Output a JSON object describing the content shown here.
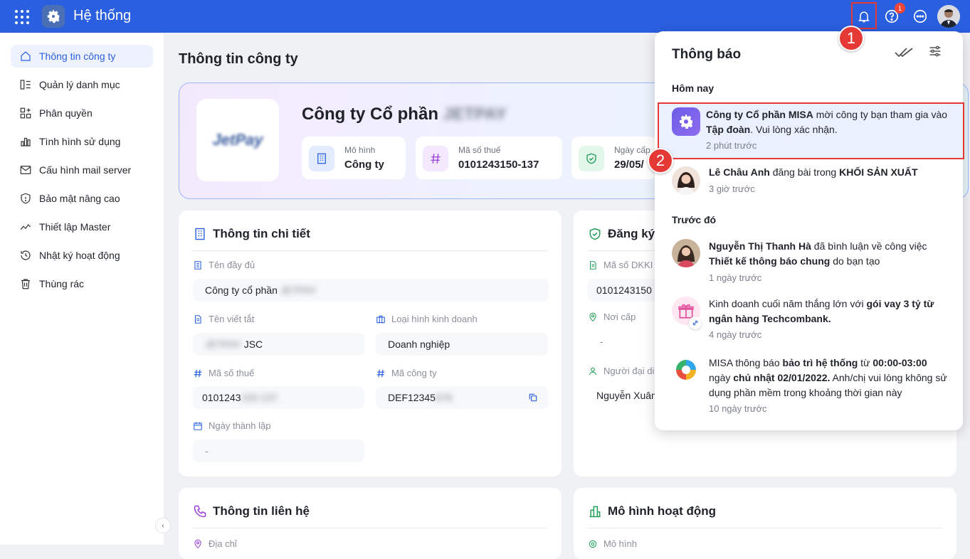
{
  "app": {
    "title": "Hệ thống",
    "help_badge": "1"
  },
  "sidebar": {
    "items": [
      {
        "label": "Thông tin công ty",
        "icon": "home-icon"
      },
      {
        "label": "Quản lý danh mục",
        "icon": "list-icon"
      },
      {
        "label": "Phân quyền",
        "icon": "grid-plus-icon"
      },
      {
        "label": "Tình hình sử dụng",
        "icon": "bar-chart-icon"
      },
      {
        "label": "Cấu hình mail server",
        "icon": "mail-icon"
      },
      {
        "label": "Bảo mật nâng cao",
        "icon": "shield-icon"
      },
      {
        "label": "Thiết lập Master",
        "icon": "trend-icon"
      },
      {
        "label": "Nhật ký hoạt động",
        "icon": "history-icon"
      },
      {
        "label": "Thùng rác",
        "icon": "trash-icon"
      }
    ]
  },
  "page": {
    "title": "Thông tin công ty"
  },
  "hero": {
    "logo_text": "JetPay",
    "name_prefix": "Công ty Cổ phần",
    "name_blur": "JETPAY",
    "stats": [
      {
        "label": "Mô hình",
        "value": "Công ty"
      },
      {
        "label": "Mã số thuế",
        "value": "0101243150-137"
      },
      {
        "label": "Ngày cấp",
        "value": "29/05/"
      }
    ]
  },
  "detail": {
    "title": "Thông tin chi tiết",
    "full_name": {
      "label": "Tên đầy đủ",
      "value": "Công ty cổ phần",
      "blur": "JETPAY"
    },
    "short_name": {
      "label": "Tên viết tắt",
      "blur": "JETPAY",
      "value": "JSC"
    },
    "business_type": {
      "label": "Loại hình kinh doanh",
      "value": "Doanh nghiệp"
    },
    "tax_code": {
      "label": "Mã số thuế",
      "value": "0101243",
      "blur": "150-137"
    },
    "company_code": {
      "label": "Mã công ty",
      "value": "DEF12345",
      "blur": "678"
    },
    "founded": {
      "label": "Ngày thành lập",
      "value": "-"
    }
  },
  "register": {
    "title": "Đăng ký",
    "dkkd": {
      "label": "Mã số DKKI",
      "value": "0101243150"
    },
    "place": {
      "label": "Nơi cấp",
      "value": "-"
    },
    "rep": {
      "label": "Người đại di",
      "value": "Nguyễn Xuân"
    }
  },
  "contact": {
    "title": "Thông tin liên hệ",
    "address_label": "Địa chỉ"
  },
  "model": {
    "title": "Mô hình hoạt động",
    "field_label": "Mô hình"
  },
  "notifications": {
    "title": "Thông báo",
    "today_label": "Hôm nay",
    "earlier_label": "Trước đó",
    "items": [
      {
        "bold1": "Công ty Cổ phần MISA",
        "text1": " mời công ty bạn tham gia vào ",
        "bold2": "Tập đoàn",
        "text2": ". Vui lòng xác nhận.",
        "time": "2 phút trước"
      },
      {
        "bold1": "Lê Châu Anh",
        "text1": " đăng bài trong ",
        "bold2": "KHỐI SẢN XUẤT",
        "text2": "",
        "time": "3 giờ trước"
      },
      {
        "bold1": "Nguyễn Thị Thanh Hà",
        "text1": " đã bình luận về công việc ",
        "bold2": "Thiết kế thông báo chung",
        "text2": " do bạn tạo",
        "time": "1 ngày trước"
      },
      {
        "bold1": "",
        "text1": "Kinh doanh cuối năm thắng lớn với ",
        "bold2": "gói vay 3 tỷ từ ngân hàng Techcombank.",
        "text2": "",
        "time": "4 ngày trước"
      },
      {
        "bold1": "",
        "text1": "MISA thông báo ",
        "bold2": "bảo trì hệ thống",
        "text2": " từ ",
        "bold3": "00:00-03:00",
        "text3": " ngày ",
        "bold4": "chủ nhật 02/01/2022.",
        "text4": " Anh/chị vui lòng không sử dụng phần mềm trong khoảng thời gian này",
        "time": "10 ngày trước"
      }
    ]
  },
  "steps": [
    "1",
    "2"
  ],
  "colors": {
    "topbar": "#2a5fe0",
    "accent": "#2a5fe0",
    "highlight": "#e53935"
  }
}
